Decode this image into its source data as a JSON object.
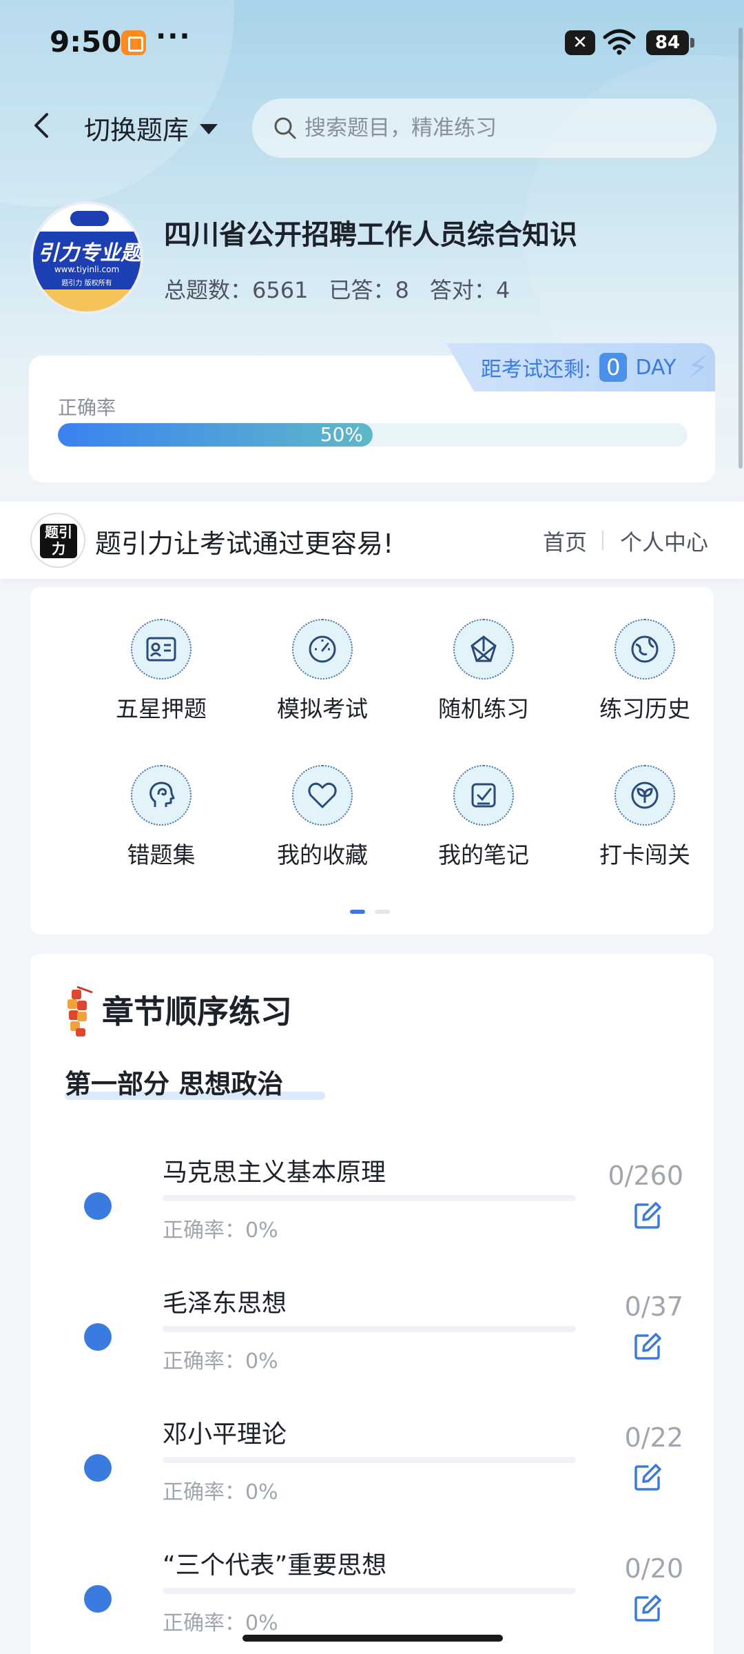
{
  "status_bar": {
    "time": "9:50",
    "more": "···",
    "battery": "84"
  },
  "nav": {
    "switch_label": "切换题库",
    "search_placeholder": "搜索题目，精准练习"
  },
  "course": {
    "logo_text": "引力专业题",
    "logo_url": "www.tiyinli.com",
    "logo_sub": "题引力 版权所有",
    "title": "四川省公开招聘工作人员综合知识",
    "stats": [
      {
        "label": "总题数：6561"
      },
      {
        "label": "已答：8"
      },
      {
        "label": "答对：4"
      }
    ]
  },
  "countdown": {
    "prefix": "距考试还剩:",
    "days": "0",
    "unit": "DAY"
  },
  "accuracy": {
    "label": "正确率",
    "percent_text": "50%",
    "percent": 50
  },
  "slogan": {
    "logo_text": "题引力",
    "text": "题引力让考试通过更容易!",
    "home": "首页",
    "me": "个人中心"
  },
  "menu": [
    {
      "label": "五星押题",
      "icon": "id-card-icon"
    },
    {
      "label": "模拟考试",
      "icon": "gauge-icon"
    },
    {
      "label": "随机练习",
      "icon": "network-icon"
    },
    {
      "label": "练习历史",
      "icon": "globe-icon"
    },
    {
      "label": "错题集",
      "icon": "head-icon"
    },
    {
      "label": "我的收藏",
      "icon": "heart-icon"
    },
    {
      "label": "我的笔记",
      "icon": "note-check-icon"
    },
    {
      "label": "打卡闯关",
      "icon": "sprout-icon"
    }
  ],
  "chapters": {
    "title": "章节顺序练习",
    "part": "第一部分  思想政治",
    "items": [
      {
        "name": "马克思主义基本原理",
        "accuracy": "正确率：0%",
        "count": "0/260"
      },
      {
        "name": "毛泽东思想",
        "accuracy": "正确率：0%",
        "count": "0/37"
      },
      {
        "name": "邓小平理论",
        "accuracy": "正确率：0%",
        "count": "0/22"
      },
      {
        "name": "“三个代表”重要思想",
        "accuracy": "正确率：0%",
        "count": "0/20"
      }
    ]
  },
  "colors": {
    "accent": "#3a7be0",
    "hero_top": "#a8d3ea",
    "muted": "#a0a6ad"
  }
}
